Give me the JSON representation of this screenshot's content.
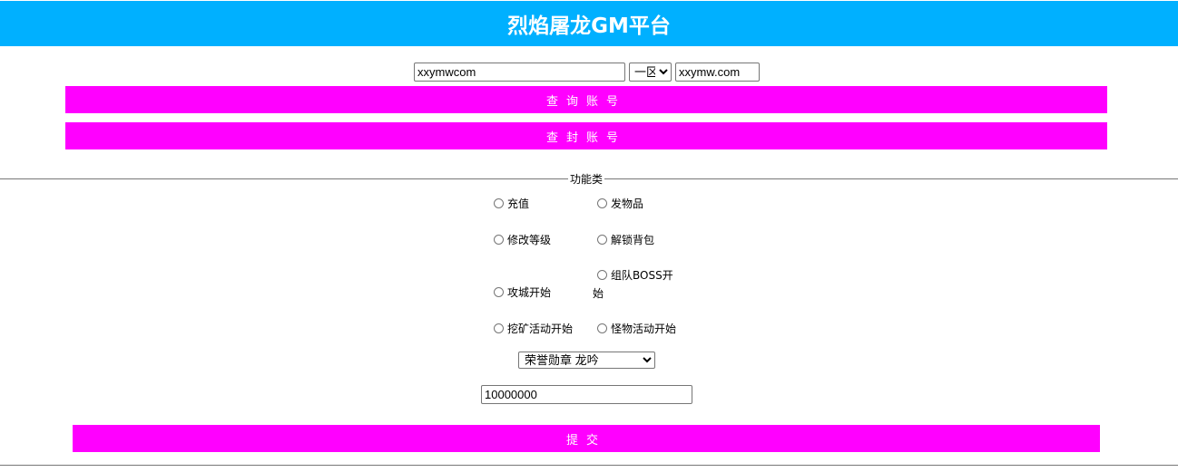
{
  "header": {
    "title": "烈焰屠龙GM平台"
  },
  "account": {
    "value": "xxymwcom"
  },
  "server": {
    "selected": "一区"
  },
  "password": {
    "value": "xxymw.com"
  },
  "buttons": {
    "query": "查询账号",
    "ban": "查封账号",
    "submit": "提交"
  },
  "fieldset": {
    "legend": "功能类"
  },
  "functions": {
    "recharge": "充值",
    "send_items": "发物品",
    "modify_level": "修改等级",
    "unlock_bag": "解锁背包",
    "team_boss_line1": "组队BOSS开",
    "team_boss_line2": "始",
    "siege_start": "攻城开始",
    "mining_start": "挖矿活动开始",
    "monster_start": "怪物活动开始"
  },
  "item": {
    "selected": "荣誉勋章 龙吟"
  },
  "amount": {
    "value": "10000000"
  },
  "colors": {
    "header_bg": "#00b0ff",
    "button_bg": "#ff00ff"
  }
}
